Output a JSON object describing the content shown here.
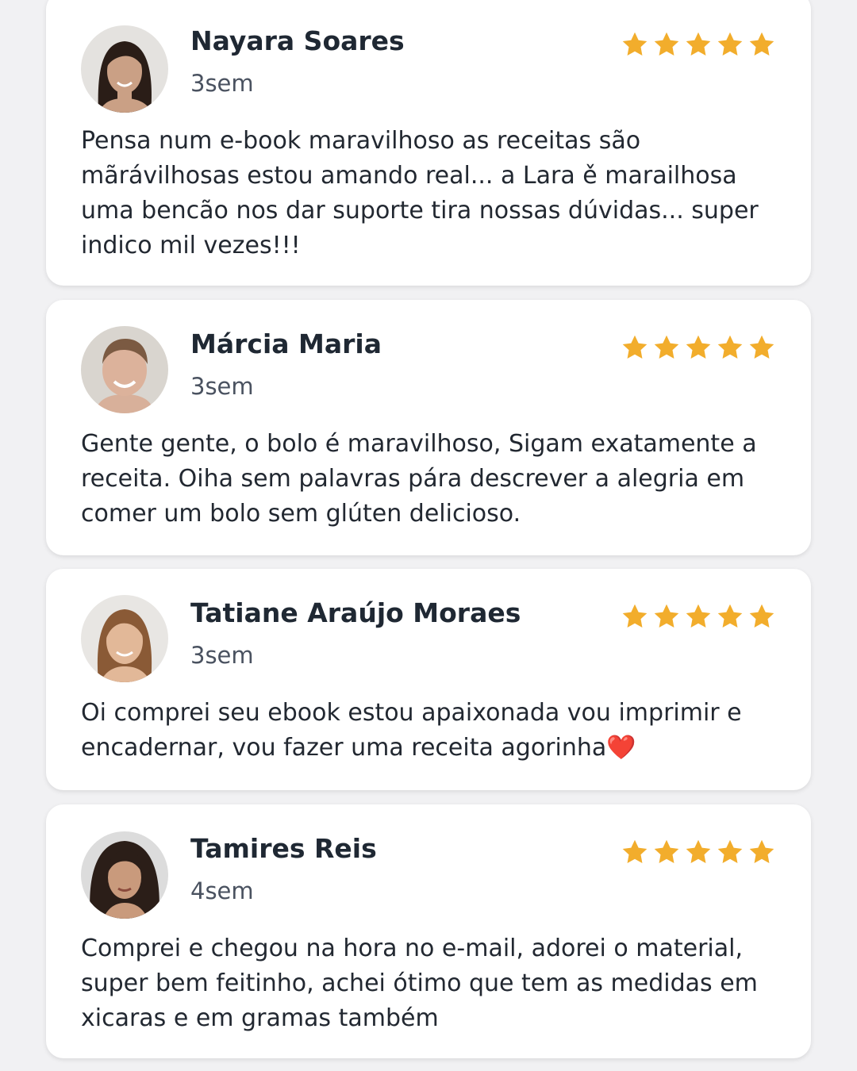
{
  "colors": {
    "background": "#f1f1f3",
    "card": "#ffffff",
    "star": "#f2ad2c",
    "name": "#1f2833",
    "text": "#222831",
    "time": "#4a5260"
  },
  "reviews": [
    {
      "name": "Nayara Soares",
      "time": "3sem",
      "rating": 5,
      "text": "Pensa num e-book maravilhoso as receitas são mãrávilhosas estou amando real... a Lara ě marailhosa uma bencão nos dar suporte tira nossas dúvidas... super indico mil vezes!!!"
    },
    {
      "name": "Márcia Maria",
      "time": "3sem",
      "rating": 5,
      "text": "Gente gente, o bolo é maravilhoso, Sigam exatamente a receita. Oiha sem palavras pára descrever a alegria em comer um bolo sem glúten delicioso."
    },
    {
      "name": "Tatiane Araújo Moraes",
      "time": "3sem",
      "rating": 5,
      "text": "Oi comprei seu ebook estou apaixonada vou imprimir e encadernar, vou fazer uma receita agorinha❤️"
    },
    {
      "name": "Tamires Reis",
      "time": "4sem",
      "rating": 5,
      "text": "Comprei e chegou na hora no e-mail, adorei o material, super bem feitinho, achei ótimo que tem as medidas em xicaras e em gramas também"
    }
  ]
}
